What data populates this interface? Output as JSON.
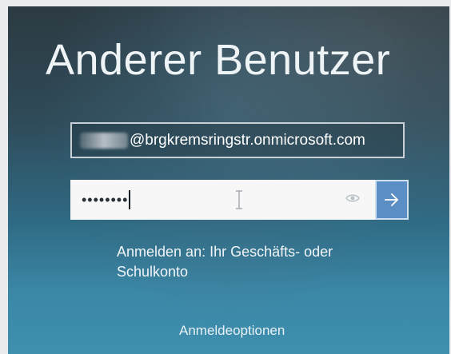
{
  "header": {
    "title": "Anderer Benutzer"
  },
  "login": {
    "email_value": "@brgkremsringstr.onmicrosoft.com",
    "email_prefix_obscured": true,
    "password_mask": "••••••••",
    "password_reveal_icon": "eye-icon",
    "submit_icon": "arrow-right-icon"
  },
  "sign_in_hint": "Anmelden an: Ihr Geschäfts- oder Schulkonto",
  "sign_in_options_label": "Anmeldeoptionen",
  "colors": {
    "accent": "#5a8ec5",
    "background_top": "#2c3a42",
    "background_bottom": "#3f8fae",
    "field_background": "#f6f7f6"
  }
}
